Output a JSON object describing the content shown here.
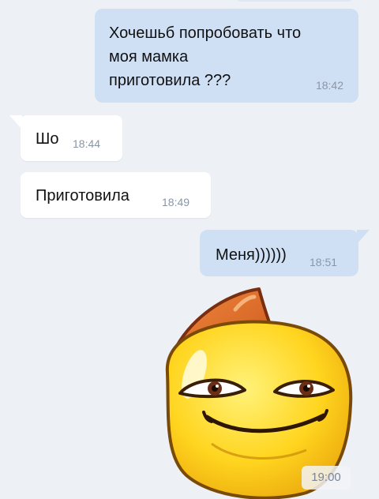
{
  "messages": [
    {
      "direction": "outgoing",
      "text": "Хочешьб попробовать что\nмоя мамка\nприготовила ???",
      "time": "18:42"
    },
    {
      "direction": "incoming",
      "text": "Шо",
      "time": "18:44"
    },
    {
      "direction": "incoming",
      "text": "Приготовила",
      "time": "18:49"
    },
    {
      "direction": "outgoing",
      "text": "Меня))))))",
      "time": "18:51"
    }
  ],
  "sticker": {
    "icon": "smirking-yellow-blob-sticker-icon",
    "time": "19:00"
  },
  "colors": {
    "background": "#edf0f5",
    "outgoing_bubble": "#cfe0f5",
    "incoming_bubble": "#ffffff",
    "timestamp": "#8a96a6"
  }
}
